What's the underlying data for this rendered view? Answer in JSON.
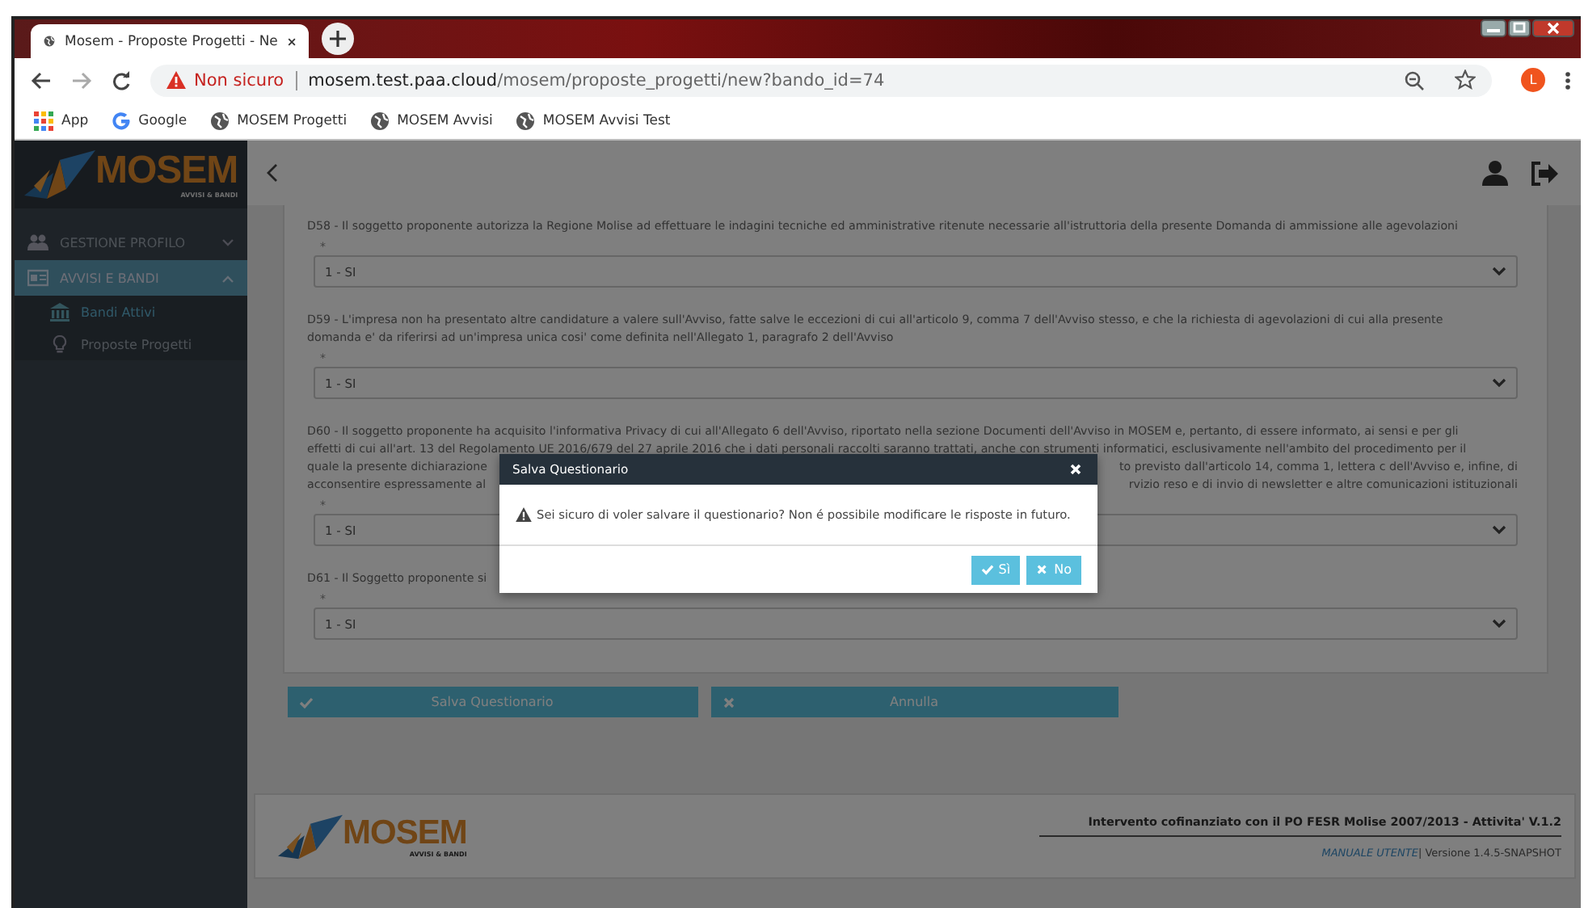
{
  "browser": {
    "tabs": [
      {
        "title": "Mosem - Proposte Progetti - Ne",
        "selected": true
      }
    ],
    "address": {
      "security": "Non sicuro",
      "url_host": "mosem.test.paa.cloud",
      "url_path": "/mosem/proposte_progetti/new?bando_id=74"
    },
    "profile": "L",
    "bookmarks": [
      {
        "label": "App",
        "kind": "apps"
      },
      {
        "label": "Google",
        "kind": "google"
      },
      {
        "label": "MOSEM Progetti",
        "kind": "globe"
      },
      {
        "label": "MOSEM Avvisi",
        "kind": "globe"
      },
      {
        "label": "MOSEM Avvisi Test",
        "kind": "globe"
      }
    ]
  },
  "logo": {
    "name": "MOSEM",
    "tagline": "AVVISI & BANDI"
  },
  "sidebar": {
    "items": [
      {
        "label": "GESTIONE PROFILO",
        "expanded": false,
        "selected": false
      },
      {
        "label": "AVVISI E BANDI",
        "expanded": true,
        "selected": true,
        "children": [
          {
            "label": "Bandi Attivi",
            "selected": true
          },
          {
            "label": "Proposte Progetti",
            "selected": false
          }
        ]
      }
    ]
  },
  "questions": [
    {
      "lines": [
        {
          "left": "D58 - Il soggetto proponente autorizza la Regione Molise ad effettuare le indagini tecniche ed amministrative ritenute necessarie all'istruttoria della presente Domanda di ammissione alle agevolazioni"
        }
      ],
      "required": "*",
      "answer": "1 - SI"
    },
    {
      "lines": [
        {
          "left": "D59 - L'impresa non ha presentato altre candidature a valere sull'Avviso, fatte salve le eccezioni di cui all'articolo 9, comma 7 dell'Avviso stesso, e che la richiesta di agevolazioni di cui alla presente"
        },
        {
          "left": "domanda e' da riferirsi ad un'impresa unica cosi' come definita nell'Allegato 1, paragrafo 2 dell'Avviso"
        }
      ],
      "required": "*",
      "answer": "1 - SI"
    },
    {
      "lines": [
        {
          "left": "D60 - Il soggetto proponente ha acquisito l'informativa Privacy di cui all'Allegato 6 dell'Avviso, riportato nella sezione Documenti dell'Avviso in MOSEM e, pertanto, di essere informato, ai sensi e per gli"
        },
        {
          "left": "effetti di cui all'art. 13 del Regolamento UE 2016/679 del 27 aprile 2016 che i dati personali raccolti saranno trattati, anche con strumenti informatici, esclusivamente nell'ambito del procedimento per il"
        },
        {
          "left": "quale la presente dichiarazione",
          "right": "to previsto dall'articolo 14, comma 1, lettera c dell'Avviso e, infine, di"
        },
        {
          "left": "acconsentire espressamente al",
          "right": "rvizio reso e di invio di newsletter e altre comunicazioni istituzionali"
        }
      ],
      "required": "*",
      "answer": "1 - SI"
    },
    {
      "lines": [
        {
          "left": "D61 - Il Soggetto proponente si"
        }
      ],
      "required": "*",
      "answer": "1 - SI"
    }
  ],
  "actions": [
    {
      "label": "Salva Questionario",
      "kind": "save"
    },
    {
      "label": "Annulla",
      "kind": "cancel"
    }
  ],
  "footer": {
    "logo": {
      "name": "MOSEM",
      "tagline": "AVVISI & BANDI"
    },
    "credit": "Intervento cofinanziato con il PO FESR Molise 2007/2013 - Attivita' V.1.2",
    "manual": "MANUALE UTENTE",
    "version": "| Versione 1.4.5-SNAPSHOT"
  },
  "modal": {
    "title": "Salva Questionario",
    "message": "Sei sicuro di voler salvare il questionario? Non é possibile modificare le risposte in futuro.",
    "buttons": [
      {
        "label": "Sì",
        "kind": "yes"
      },
      {
        "label": "No",
        "kind": "no"
      }
    ]
  }
}
